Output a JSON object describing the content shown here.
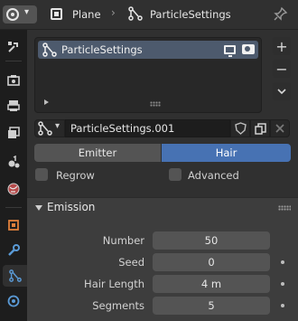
{
  "header": {
    "object_name": "Plane",
    "separator": "›",
    "particle_name": "ParticleSettings"
  },
  "particle_list": {
    "items": [
      {
        "label": "ParticleSettings"
      }
    ]
  },
  "side_buttons": {
    "add": "+",
    "remove": "−",
    "menu": "⌄"
  },
  "datablock": {
    "name": "ParticleSettings.001"
  },
  "type_toggle": {
    "emitter": "Emitter",
    "hair": "Hair",
    "selected": "Hair"
  },
  "options": {
    "regrow": {
      "label": "Regrow",
      "checked": false
    },
    "advanced": {
      "label": "Advanced",
      "checked": false
    }
  },
  "emission": {
    "title": "Emission",
    "props": [
      {
        "label": "Number",
        "value": "50"
      },
      {
        "label": "Seed",
        "value": "0"
      },
      {
        "label": "Hair Length",
        "value": "4 m"
      },
      {
        "label": "Segments",
        "value": "5"
      }
    ]
  },
  "colors": {
    "accent": "#4772b3",
    "list_highlight": "#4d5a6d",
    "background": "#303030",
    "panel": "#3d3d3d"
  },
  "tab_icons": [
    "tool-icon",
    "render-icon",
    "output-icon",
    "view-layer-icon",
    "scene-icon",
    "world-icon",
    "object-icon",
    "modifier-icon",
    "particles-icon",
    "physics-icon"
  ]
}
